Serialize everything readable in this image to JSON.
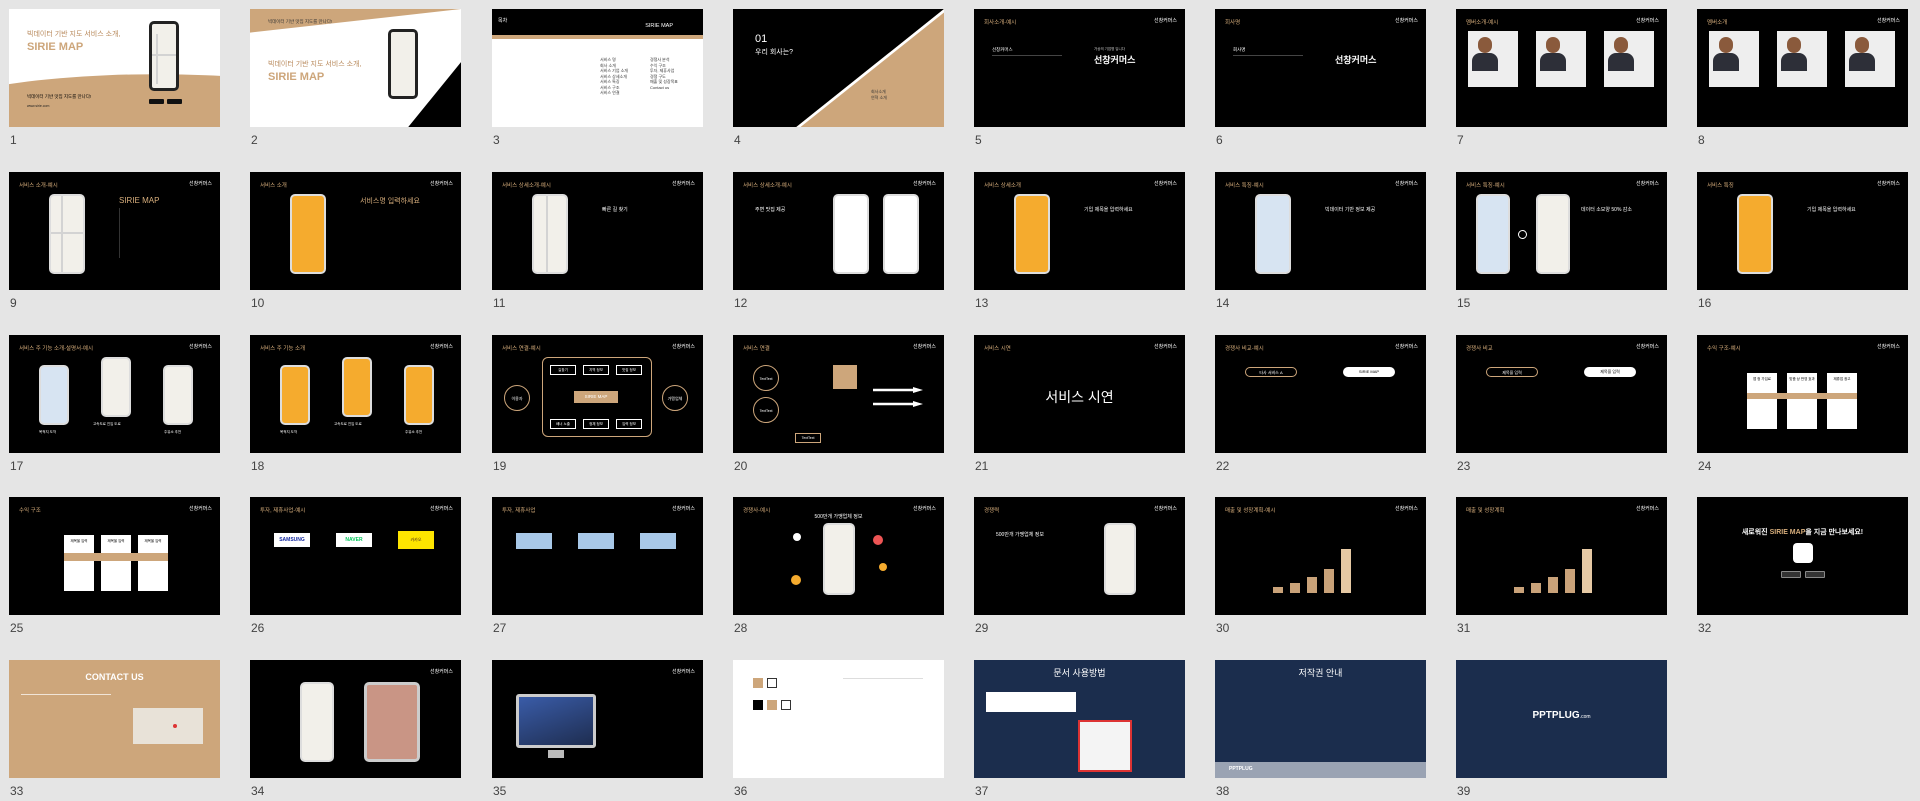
{
  "slides": [
    {
      "n": "1",
      "h1": "빅데이터 기반 지도 서비스 소개,",
      "h2": "SIRIE MAP",
      "sub": "빅데이터 기반 맛집 지도를 만나다!",
      "url": "www.sirie.com"
    },
    {
      "n": "2",
      "top": "빅데이터 기반 맛집 지도를 만나다!",
      "h1": "빅데이터 기반 지도 서비스 소개,",
      "h2": "SIRIE MAP"
    },
    {
      "n": "3",
      "t": "목차",
      "right": "SIRIE MAP",
      "col1": [
        "서비스 명",
        "회사 소개",
        "서비스 기업 소개",
        "서비스 상세소개",
        "서비스 특징",
        "서비스 구조",
        "서비스 연결"
      ],
      "col2": [
        "경쟁사 분석",
        "수익 구조",
        "투자, 제휴사업",
        "경쟁 구도",
        "매출 및 성장목표",
        "Contact us"
      ]
    },
    {
      "n": "4",
      "num": "01",
      "t": "우리 회사는?",
      "items": [
        "회사소개",
        "연혁 소개"
      ]
    },
    {
      "n": "5",
      "hdr": "회사소개-예시",
      "logo": "선창커머스",
      "company": "선창커머스",
      "brand": "선창커머스",
      "brand_sub": "가상의 기업명 입니다"
    },
    {
      "n": "6",
      "hdr": "회사명",
      "logo": "선창커머스",
      "company": "회사명",
      "brand": "선창커머스"
    },
    {
      "n": "7",
      "hdr": "멤버소개-예시",
      "logo": "선창커머스"
    },
    {
      "n": "8",
      "hdr": "멤버소개",
      "logo": "선창커머스"
    },
    {
      "n": "9",
      "hdr": "서비스 소개-예시",
      "logo": "선창커머스",
      "title": "SIRIE MAP"
    },
    {
      "n": "10",
      "hdr": "서비스 소개",
      "logo": "선창커머스",
      "title": "서비스명 입력하세요"
    },
    {
      "n": "11",
      "hdr": "서비스 상세소개-예시",
      "logo": "선창커머스",
      "title": "빠른 길 찾기"
    },
    {
      "n": "12",
      "hdr": "서비스 상세소개-예시",
      "logo": "선창커머스",
      "title": "주변 맛집 제공"
    },
    {
      "n": "13",
      "hdr": "서비스 상세소개",
      "logo": "선창커머스",
      "title": "기입 제목을 입력하세요"
    },
    {
      "n": "14",
      "hdr": "서비스 특징-예시",
      "logo": "선창커머스",
      "title": "빅데이터 기반 정보 제공"
    },
    {
      "n": "15",
      "hdr": "서비스 특징-예시",
      "logo": "선창커머스",
      "title": "데이터 소모양 50% 감소"
    },
    {
      "n": "16",
      "hdr": "서비스 특징",
      "logo": "선창커머스",
      "title": "기입 제목을 입력하세요"
    },
    {
      "n": "17",
      "hdr": "서비스 주 기능 소개-설명서-예시",
      "logo": "선창커머스",
      "labels": [
        "목적지 도착",
        "고속도로 진입 도로",
        "주유소 추천"
      ]
    },
    {
      "n": "18",
      "hdr": "서비스 주 기능 소개",
      "logo": "선창커머스",
      "labels": [
        "목적지 도착",
        "고속도로 진입 도로",
        "주유소 추천"
      ]
    },
    {
      "n": "19",
      "hdr": "서비스 연결-예시",
      "logo": "선창커머스",
      "center": "SIRIE MAP",
      "left": "이용자",
      "right": "가맹업체",
      "boxes": [
        "길찾기",
        "지역 정보",
        "맛집 정보",
        "배너 노출",
        "정체 정보",
        "입력 정보"
      ]
    },
    {
      "n": "20",
      "hdr": "서비스 연결",
      "logo": "선창커머스",
      "circles": [
        "TextText",
        "TextText"
      ],
      "label": "TextText"
    },
    {
      "n": "21",
      "hdr": "서비스 시연",
      "logo": "선창커머스",
      "title": "서비스 시연"
    },
    {
      "n": "22",
      "hdr": "경쟁사 비교-예시",
      "logo": "선창커머스",
      "a": "타사 서비스 A",
      "b": "SIRIE MAP"
    },
    {
      "n": "23",
      "hdr": "경쟁사 비교",
      "logo": "선창커머스",
      "a": "제목을 입력",
      "b": "제목을 입력"
    },
    {
      "n": "24",
      "hdr": "수익 구조-예시",
      "logo": "선창커머스",
      "cols": [
        "앱 정 가입료",
        "맞춤 상 반영 효과",
        "제휴업 광고"
      ]
    },
    {
      "n": "25",
      "hdr": "수익 구조",
      "logo": "선창커머스",
      "cols": [
        "제목을 입력",
        "제목을 입력",
        "제목을 입력"
      ]
    },
    {
      "n": "26",
      "hdr": "투자, 제휴사업-예시",
      "logo": "선창커머스",
      "brands": [
        "SAMSUNG",
        "NAVER",
        "카카오"
      ]
    },
    {
      "n": "27",
      "hdr": "투자, 제휴사업",
      "logo": "선창커머스"
    },
    {
      "n": "28",
      "hdr": "경쟁사-예시",
      "logo": "선창커머스",
      "title": "500만개 가맹업체 정보"
    },
    {
      "n": "29",
      "hdr": "경쟁력",
      "logo": "선창커머스",
      "title": "500만개 가맹업체 정보"
    },
    {
      "n": "30",
      "hdr": "매출 및 성장계획-예시",
      "logo": "선창커머스"
    },
    {
      "n": "31",
      "hdr": "매출 및 성장계획",
      "logo": "선창커머스"
    },
    {
      "n": "32",
      "title_a": "새로워진",
      "title_b": "SIRIE MAP",
      "title_c": "을 지금 만나보세요!"
    },
    {
      "n": "33",
      "title": "CONTACT US"
    },
    {
      "n": "34",
      "logo": "선창커머스"
    },
    {
      "n": "35",
      "logo": "선창커머스"
    },
    {
      "n": "36"
    },
    {
      "n": "37",
      "title": "문서 사용방법"
    },
    {
      "n": "38",
      "title": "저작권 안내",
      "footer": "PPTPLUG"
    },
    {
      "n": "39",
      "brand": "PPTPLUG",
      "brand_sub": ".com"
    }
  ],
  "colors": {
    "bg": "#e5e5e5",
    "tan": "#cda67b",
    "black": "#000000",
    "navy": "#1b2d4d",
    "phone_yellow": "#f5ab2e"
  }
}
